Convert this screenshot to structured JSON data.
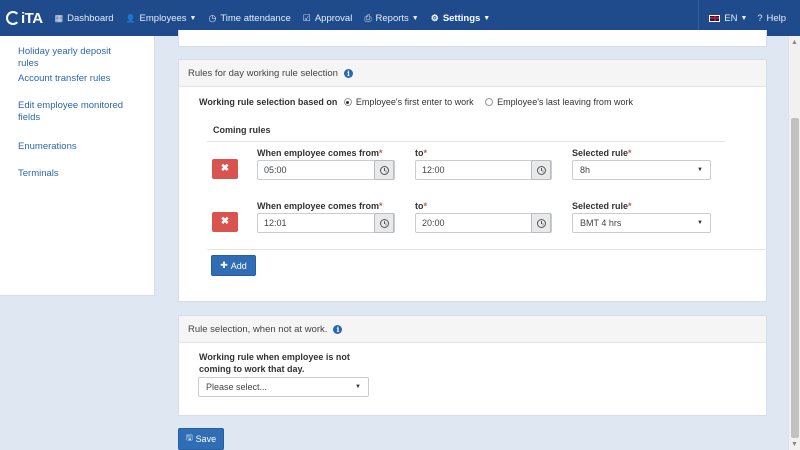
{
  "nav": {
    "logo": "iTA",
    "items": [
      {
        "icon": "grid-icon",
        "glyph": "▦",
        "label": "Dashboard"
      },
      {
        "icon": "user-icon",
        "glyph": "👤",
        "label": "Employees"
      },
      {
        "icon": "clock-icon",
        "glyph": "◷",
        "label": "Time attendance"
      },
      {
        "icon": "checkbox-icon",
        "glyph": "☑",
        "label": "Approval"
      },
      {
        "icon": "printer-icon",
        "glyph": "⎙",
        "label": "Reports"
      },
      {
        "icon": "gear-icon",
        "glyph": "⚙",
        "label": "Settings"
      }
    ],
    "language": "EN",
    "help": "Help",
    "help_glyph": "?"
  },
  "sidebar": {
    "items": [
      {
        "label": "Holiday yearly deposit rules"
      },
      {
        "label": "Account transfer rules"
      },
      {
        "label": "Edit employee monitored fields"
      },
      {
        "label": "Enumerations"
      },
      {
        "label": "Terminals"
      }
    ]
  },
  "day_rules": {
    "title": "Rules for day working rule selection",
    "based_on_label": "Working rule selection based on",
    "option_first_enter": "Employee's first enter to work",
    "option_last_leaving": "Employee's last leaving from work",
    "selected_option": "first_enter",
    "coming_rules_title": "Coming rules",
    "from_label": "When employee comes from",
    "to_label": "to",
    "rule_label": "Selected rule",
    "required_mark": "*",
    "delete_glyph": "✖",
    "rules": [
      {
        "from": "05:00",
        "to": "12:00",
        "rule": "8h"
      },
      {
        "from": "12:01",
        "to": "20:00",
        "rule": "BMT 4 hrs"
      }
    ],
    "add_label": "Add",
    "add_glyph": "✚"
  },
  "not_at_work": {
    "title": "Rule selection, when not at work.",
    "field_label_line1": "Working rule when employee is not",
    "field_label_line2": "coming to work that day.",
    "placeholder": "Please select..."
  },
  "save_label": "Save",
  "save_glyph": "🖫",
  "colors": {
    "nav_bg": "#1f4a8b",
    "primary": "#2f6db5",
    "danger": "#d9534f",
    "link": "#2a67ae",
    "page_bg": "#dfe7f3"
  }
}
